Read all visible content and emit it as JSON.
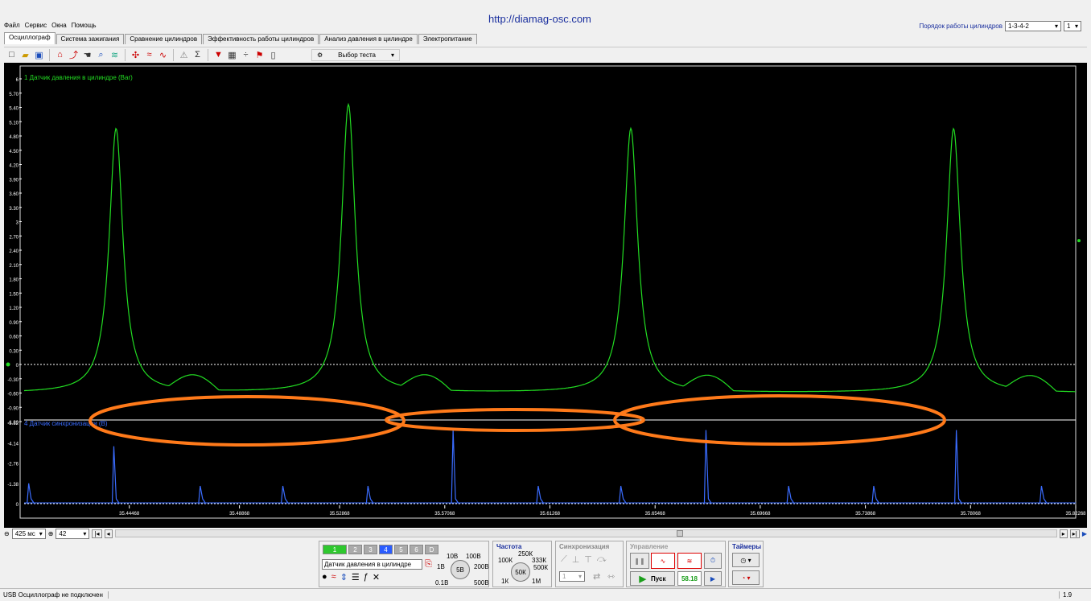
{
  "menu": [
    "Файл",
    "Сервис",
    "Окна",
    "Помощь"
  ],
  "url": "http://diamag-osc.com",
  "order": {
    "label": "Порядок работы цилиндров",
    "value": "1-3-4-2",
    "num": "1"
  },
  "tabs": [
    "Осциллограф",
    "Система зажигания",
    "Сравнение цилиндров",
    "Эффективность работы цилиндров",
    "Анализ давления в цилиндре",
    "Электропитание"
  ],
  "test_select": "Выбор теста",
  "channel1": {
    "label": "1 Датчик давления в цилиндре (Bar)",
    "color": "#22dd22",
    "ticks": [
      "6",
      "5.70",
      "5.40",
      "5.10",
      "4.80",
      "4.50",
      "4.20",
      "3.90",
      "3.60",
      "3.30",
      "3",
      "2.70",
      "2.40",
      "2.10",
      "1.80",
      "1.50",
      "1.20",
      "0.90",
      "0.60",
      "0.30",
      "0",
      "-0.30",
      "-0.60",
      "-0.90",
      "-1.20"
    ]
  },
  "channel4": {
    "label": "4 Датчик синхронизации (B)",
    "color": "#3a6cff",
    "ticks": [
      "-5.52",
      "-4.14",
      "-2.76",
      "-1.38",
      "0"
    ]
  },
  "time_ticks": [
    "35.44468",
    "35.48868",
    "35.52868",
    "35.57068",
    "35.61268",
    "35.65468",
    "35.69668",
    "35.73868",
    "35.78068",
    "35.82268"
  ],
  "chart_data": {
    "type": "line",
    "x_range": [
      35.40268,
      35.82268
    ],
    "series": [
      {
        "name": "1 Датчик давления в цилиндре (Bar)",
        "peaks_x": [
          35.4394,
          35.5322,
          35.645,
          35.7739
        ],
        "peaks_y": [
          4.95,
          5.45,
          4.95,
          4.95
        ],
        "baseline": -0.6
      },
      {
        "name": "4 Датчик синхронизации (B)",
        "pulse_x": [
          35.4045,
          35.4385,
          35.473,
          35.506,
          35.54,
          35.574,
          35.608,
          35.641,
          35.675,
          35.708,
          35.742,
          35.775,
          35.809
        ],
        "pulse_y": [
          1.38,
          3.9,
          1.2,
          1.2,
          1.2,
          5.0,
          1.2,
          1.2,
          5.0,
          1.2,
          1.2,
          5.0,
          1.2
        ]
      }
    ]
  },
  "bottom": {
    "timebase": "425 мс",
    "zoom": "42",
    "channels": [
      "1",
      "2",
      "3",
      "4",
      "5",
      "6",
      "D"
    ],
    "sensor": "Датчик давления в цилиндре",
    "volt_labels": [
      "10В",
      "100В",
      "1В",
      "200В",
      "0.1В",
      "500В",
      "5В"
    ],
    "freq_title": "Частота",
    "freq_labels": [
      "250К",
      "100К",
      "333К",
      "500К",
      "1К",
      "1М",
      "50К"
    ],
    "sync_title": "Синхронизация",
    "sync_value": "1",
    "ctrl_title": "Управление",
    "start": "Пуск",
    "rpm": "58.18",
    "timers_title": "Таймеры"
  },
  "status": {
    "left": "USB Осциллограф не подключен",
    "right": "1.9"
  }
}
